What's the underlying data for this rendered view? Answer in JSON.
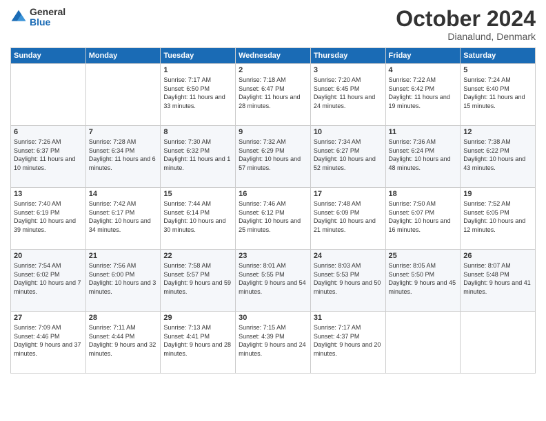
{
  "logo": {
    "general": "General",
    "blue": "Blue"
  },
  "header": {
    "month": "October 2024",
    "location": "Dianalund, Denmark"
  },
  "days_of_week": [
    "Sunday",
    "Monday",
    "Tuesday",
    "Wednesday",
    "Thursday",
    "Friday",
    "Saturday"
  ],
  "weeks": [
    [
      {
        "day": "",
        "sunrise": "",
        "sunset": "",
        "daylight": ""
      },
      {
        "day": "",
        "sunrise": "",
        "sunset": "",
        "daylight": ""
      },
      {
        "day": "1",
        "sunrise": "Sunrise: 7:17 AM",
        "sunset": "Sunset: 6:50 PM",
        "daylight": "Daylight: 11 hours and 33 minutes."
      },
      {
        "day": "2",
        "sunrise": "Sunrise: 7:18 AM",
        "sunset": "Sunset: 6:47 PM",
        "daylight": "Daylight: 11 hours and 28 minutes."
      },
      {
        "day": "3",
        "sunrise": "Sunrise: 7:20 AM",
        "sunset": "Sunset: 6:45 PM",
        "daylight": "Daylight: 11 hours and 24 minutes."
      },
      {
        "day": "4",
        "sunrise": "Sunrise: 7:22 AM",
        "sunset": "Sunset: 6:42 PM",
        "daylight": "Daylight: 11 hours and 19 minutes."
      },
      {
        "day": "5",
        "sunrise": "Sunrise: 7:24 AM",
        "sunset": "Sunset: 6:40 PM",
        "daylight": "Daylight: 11 hours and 15 minutes."
      }
    ],
    [
      {
        "day": "6",
        "sunrise": "Sunrise: 7:26 AM",
        "sunset": "Sunset: 6:37 PM",
        "daylight": "Daylight: 11 hours and 10 minutes."
      },
      {
        "day": "7",
        "sunrise": "Sunrise: 7:28 AM",
        "sunset": "Sunset: 6:34 PM",
        "daylight": "Daylight: 11 hours and 6 minutes."
      },
      {
        "day": "8",
        "sunrise": "Sunrise: 7:30 AM",
        "sunset": "Sunset: 6:32 PM",
        "daylight": "Daylight: 11 hours and 1 minute."
      },
      {
        "day": "9",
        "sunrise": "Sunrise: 7:32 AM",
        "sunset": "Sunset: 6:29 PM",
        "daylight": "Daylight: 10 hours and 57 minutes."
      },
      {
        "day": "10",
        "sunrise": "Sunrise: 7:34 AM",
        "sunset": "Sunset: 6:27 PM",
        "daylight": "Daylight: 10 hours and 52 minutes."
      },
      {
        "day": "11",
        "sunrise": "Sunrise: 7:36 AM",
        "sunset": "Sunset: 6:24 PM",
        "daylight": "Daylight: 10 hours and 48 minutes."
      },
      {
        "day": "12",
        "sunrise": "Sunrise: 7:38 AM",
        "sunset": "Sunset: 6:22 PM",
        "daylight": "Daylight: 10 hours and 43 minutes."
      }
    ],
    [
      {
        "day": "13",
        "sunrise": "Sunrise: 7:40 AM",
        "sunset": "Sunset: 6:19 PM",
        "daylight": "Daylight: 10 hours and 39 minutes."
      },
      {
        "day": "14",
        "sunrise": "Sunrise: 7:42 AM",
        "sunset": "Sunset: 6:17 PM",
        "daylight": "Daylight: 10 hours and 34 minutes."
      },
      {
        "day": "15",
        "sunrise": "Sunrise: 7:44 AM",
        "sunset": "Sunset: 6:14 PM",
        "daylight": "Daylight: 10 hours and 30 minutes."
      },
      {
        "day": "16",
        "sunrise": "Sunrise: 7:46 AM",
        "sunset": "Sunset: 6:12 PM",
        "daylight": "Daylight: 10 hours and 25 minutes."
      },
      {
        "day": "17",
        "sunrise": "Sunrise: 7:48 AM",
        "sunset": "Sunset: 6:09 PM",
        "daylight": "Daylight: 10 hours and 21 minutes."
      },
      {
        "day": "18",
        "sunrise": "Sunrise: 7:50 AM",
        "sunset": "Sunset: 6:07 PM",
        "daylight": "Daylight: 10 hours and 16 minutes."
      },
      {
        "day": "19",
        "sunrise": "Sunrise: 7:52 AM",
        "sunset": "Sunset: 6:05 PM",
        "daylight": "Daylight: 10 hours and 12 minutes."
      }
    ],
    [
      {
        "day": "20",
        "sunrise": "Sunrise: 7:54 AM",
        "sunset": "Sunset: 6:02 PM",
        "daylight": "Daylight: 10 hours and 7 minutes."
      },
      {
        "day": "21",
        "sunrise": "Sunrise: 7:56 AM",
        "sunset": "Sunset: 6:00 PM",
        "daylight": "Daylight: 10 hours and 3 minutes."
      },
      {
        "day": "22",
        "sunrise": "Sunrise: 7:58 AM",
        "sunset": "Sunset: 5:57 PM",
        "daylight": "Daylight: 9 hours and 59 minutes."
      },
      {
        "day": "23",
        "sunrise": "Sunrise: 8:01 AM",
        "sunset": "Sunset: 5:55 PM",
        "daylight": "Daylight: 9 hours and 54 minutes."
      },
      {
        "day": "24",
        "sunrise": "Sunrise: 8:03 AM",
        "sunset": "Sunset: 5:53 PM",
        "daylight": "Daylight: 9 hours and 50 minutes."
      },
      {
        "day": "25",
        "sunrise": "Sunrise: 8:05 AM",
        "sunset": "Sunset: 5:50 PM",
        "daylight": "Daylight: 9 hours and 45 minutes."
      },
      {
        "day": "26",
        "sunrise": "Sunrise: 8:07 AM",
        "sunset": "Sunset: 5:48 PM",
        "daylight": "Daylight: 9 hours and 41 minutes."
      }
    ],
    [
      {
        "day": "27",
        "sunrise": "Sunrise: 7:09 AM",
        "sunset": "Sunset: 4:46 PM",
        "daylight": "Daylight: 9 hours and 37 minutes."
      },
      {
        "day": "28",
        "sunrise": "Sunrise: 7:11 AM",
        "sunset": "Sunset: 4:44 PM",
        "daylight": "Daylight: 9 hours and 32 minutes."
      },
      {
        "day": "29",
        "sunrise": "Sunrise: 7:13 AM",
        "sunset": "Sunset: 4:41 PM",
        "daylight": "Daylight: 9 hours and 28 minutes."
      },
      {
        "day": "30",
        "sunrise": "Sunrise: 7:15 AM",
        "sunset": "Sunset: 4:39 PM",
        "daylight": "Daylight: 9 hours and 24 minutes."
      },
      {
        "day": "31",
        "sunrise": "Sunrise: 7:17 AM",
        "sunset": "Sunset: 4:37 PM",
        "daylight": "Daylight: 9 hours and 20 minutes."
      },
      {
        "day": "",
        "sunrise": "",
        "sunset": "",
        "daylight": ""
      },
      {
        "day": "",
        "sunrise": "",
        "sunset": "",
        "daylight": ""
      }
    ]
  ]
}
